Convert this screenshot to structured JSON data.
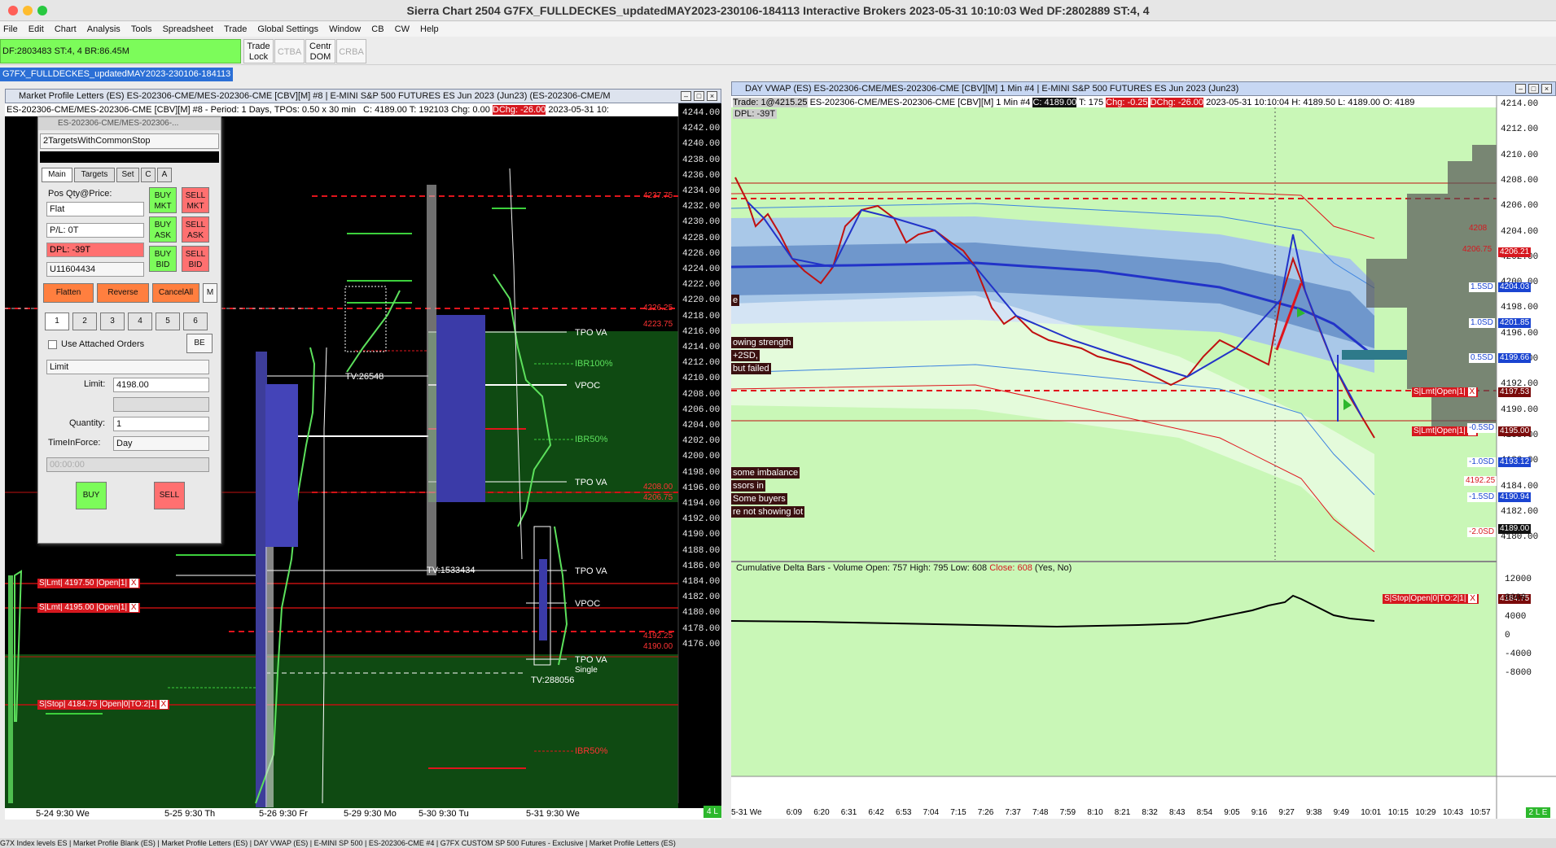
{
  "window": {
    "title": "Sierra Chart 2504 G7FX_FULLDECKES_updatedMAY2023-230106-184113 Interactive Brokers 2023-05-31 10:10:03 Wed  DF:2802889  ST:4, 4"
  },
  "menu": [
    "File",
    "Edit",
    "Chart",
    "Analysis",
    "Tools",
    "Spreadsheet",
    "Trade",
    "Global Settings",
    "Window",
    "CB",
    "CW",
    "Help"
  ],
  "toolbar": {
    "status": "DF:2803483  ST:4, 4  BR:86.45M",
    "trade_lock": "Trade Lock",
    "ctba": "CTBA",
    "centr_dom": "Centr DOM",
    "crba": "CRBA"
  },
  "chartbook_tab": "G7FX_FULLDECKES_updatedMAY2023-230106-184113",
  "left_window": {
    "title": "Market Profile Letters (ES) ES-202306-CME/MES-202306-CME [CBV][M] #8 | E-MINI S&P 500 FUTURES ES Jun 2023 (Jun23) (ES-202306-CME/M",
    "header_symbol": "ES-202306-CME/MES-202306-CME [CBV][M] #8 - Period: 1 Days, TPOs: 0.50 x 30 min",
    "header_c": "C: 4189.00",
    "header_t": "T: 192103",
    "header_chg": "Chg: 0.00",
    "header_dchg": "DChg: -26.00",
    "header_date": "2023-05-31  10:",
    "y_labels": [
      "4244.00",
      "4242.00",
      "4240.00",
      "4238.00",
      "4236.00",
      "4234.00",
      "4232.00",
      "4230.00",
      "4228.00",
      "4226.00",
      "4224.00",
      "4222.00",
      "4220.00",
      "4218.00",
      "4216.00",
      "4214.00",
      "4212.00",
      "4210.00",
      "4208.00",
      "4206.00",
      "4204.00",
      "4202.00",
      "4200.00",
      "4198.00",
      "4196.00",
      "4194.00",
      "4192.00",
      "4190.00",
      "4188.00",
      "4186.00",
      "4184.00",
      "4182.00",
      "4180.00",
      "4178.00",
      "4176.00"
    ],
    "x_labels": [
      "5-24  9:30 We",
      "5-25  9:30 Th",
      "5-26  9:30 Fr",
      "5-29  9:30 Mo",
      "5-30  9:30 Tu",
      "5-31  9:30 We"
    ],
    "corner_label": "4 L",
    "levels": {
      "tpo_va_1": "TPO VA",
      "ibr100": "IBR100%",
      "vpoc_1": "VPOC",
      "ibr50_1": "IBR50%",
      "tpo_va_2": "TPO VA",
      "tpo_va_3": "TPO VA",
      "vpoc_2": "VPOC",
      "tpo_va_4": "TPO VA",
      "ibr50_2": "IBR50%",
      "single": "Single",
      "tv1": "TV:26548",
      "tv2": "TV:1533434",
      "tv3": "TV:288056"
    },
    "price_tags": {
      "p4237": "4237.75",
      "p4226": "4226.25",
      "p4223": "4223.75",
      "p4208": "4208.00",
      "p4206": "4206.75",
      "p4192": "4192.25",
      "p4190": "4190.00"
    },
    "orders": {
      "o1": "S|Lmt| 4197.50 |Open|1|",
      "o2": "S|Lmt| 4195.00 |Open|1|",
      "o3": "S|Stop| 4184.75 |Open|0|TO:2|1|"
    },
    "order_x": "X"
  },
  "order_panel": {
    "title": "ES-202306-CME/MES-202306-...",
    "strategy": "2TargetsWithCommonStop",
    "tabs": [
      "Main",
      "Targets",
      "Set",
      "C",
      "A"
    ],
    "pos_label": "Pos Qty@Price:",
    "pos_value": "Flat",
    "pl_value": "P/L: 0T",
    "dpl_value": "DPL: -39T",
    "account": "U11604434",
    "buy_mkt": "BUY MKT",
    "sell_mkt": "SELL MKT",
    "buy_ask": "BUY ASK",
    "sell_ask": "SELL ASK",
    "buy_bid": "BUY BID",
    "sell_bid": "SELL BID",
    "flatten": "Flatten",
    "reverse": "Reverse",
    "cancel_all": "CancelAll",
    "m": "M",
    "qty_buttons": [
      "1",
      "2",
      "3",
      "4",
      "5",
      "6"
    ],
    "use_attached": "Use Attached Orders",
    "be": "BE",
    "order_type": "Limit",
    "limit_label": "Limit:",
    "limit_value": "4198.00",
    "quantity_label": "Quantity:",
    "quantity_value": "1",
    "tif_label": "TimeInForce:",
    "tif_value": "Day",
    "time_value": "00:00:00",
    "buy": "BUY",
    "sell": "SELL"
  },
  "right_window": {
    "title": "DAY VWAP (ES) ES-202306-CME/MES-202306-CME [CBV][M]  1 Min  #4 | E-MINI S&P 500 FUTURES ES Jun 2023 (Jun23)",
    "hdr_trade": "Trade: 1@4215.25",
    "hdr_symbol": "ES-202306-CME/MES-202306-CME [CBV][M]  1 Min  #4",
    "hdr_c": "C: 4189.00",
    "hdr_t": "T: 175",
    "hdr_chg": "Chg: -0.25",
    "hdr_dchg": "DChg: -26.00",
    "hdr_time": "2023-05-31 10:10:04 H: 4189.50 L: 4189.00 O: 4189",
    "dpl": "DPL: -39T",
    "y_labels": [
      "4214.00",
      "4212.00",
      "4210.00",
      "4208.00",
      "4206.00",
      "4204.00",
      "4202.00",
      "4200.00",
      "4198.00",
      "4196.00",
      "4194.00",
      "4192.00",
      "4190.00",
      "4188.00",
      "4186.00",
      "4184.00",
      "4182.00",
      "4180.00"
    ],
    "x_labels": [
      "5-31 We",
      "6:09",
      "6:20",
      "6:31",
      "6:42",
      "6:53",
      "7:04",
      "7:15",
      "7:26",
      "7:37",
      "7:48",
      "7:59",
      "8:10",
      "8:21",
      "8:32",
      "8:43",
      "8:54",
      "9:05",
      "9:16",
      "9:27",
      "9:38",
      "9:49",
      "10:01",
      "10:15",
      "10:29",
      "10:43",
      "10:57"
    ],
    "corner_label": "2 L E",
    "sd_tags": {
      "p2sd": "4206.75",
      "p2sd_val": "4206.21",
      "p15": "1.5SD",
      "p15_val": "4204.03",
      "p10": "1.0SD",
      "p10_val": "4201.85",
      "p05": "0.5SD",
      "p05_val": "4199.66",
      "o1_val": "4197.53",
      "o2_val": "4195.00",
      "m05": "-0.5SD",
      "m10": "-1.0SD",
      "m10_val": "4193.12",
      "p4192": "4192.25",
      "m15": "-1.5SD",
      "m15_val": "4190.94",
      "last": "4189.00",
      "m20": "-2.0SD",
      "stop_val": "4184.75",
      "r4208": "4208"
    },
    "orders": {
      "o1": "S|Lmt|Open|1|",
      "o2": "S|Lmt|Open|1|",
      "stop": "S|Stop|Open|0|TO:2|1|"
    },
    "annotations": {
      "a1": "e",
      "a2": "owing strength",
      "a3": "+2SD,",
      "a4": "but failed",
      "a5": "some imbalance",
      "a6": "ssors in",
      "a7": "Some buyers",
      "a8": "re not showing lot"
    },
    "delta": {
      "title": "Cumulative Delta Bars - Volume  Open: 757  High: 795  Low: 608",
      "close": "Close: 608",
      "tail": "(Yes, No)",
      "y_labels": [
        "12000",
        "8000",
        "4000",
        "0",
        "-4000",
        "-8000"
      ]
    }
  },
  "bottom_tabs": "G7X  Index levels ES | Market Profile Blank (ES) | Market Profile Letters (ES) | DAY VWAP (ES) | E-MINI SP 500 | ES-202306-CME #4 | G7FX CUSTOM SP 500 Futures - Exclusive | Market Profile Letters (ES)",
  "colors": {
    "accent_blue": "#2b6fd6",
    "buy_green": "#7CFC5A",
    "sell_red": "#ff7070",
    "orange": "#ff7f3f",
    "profile_green": "#5ce05c",
    "level_red": "#e0141c",
    "vwap_blue": "#2233c8",
    "light_green_bg": "#c9f7b7"
  }
}
